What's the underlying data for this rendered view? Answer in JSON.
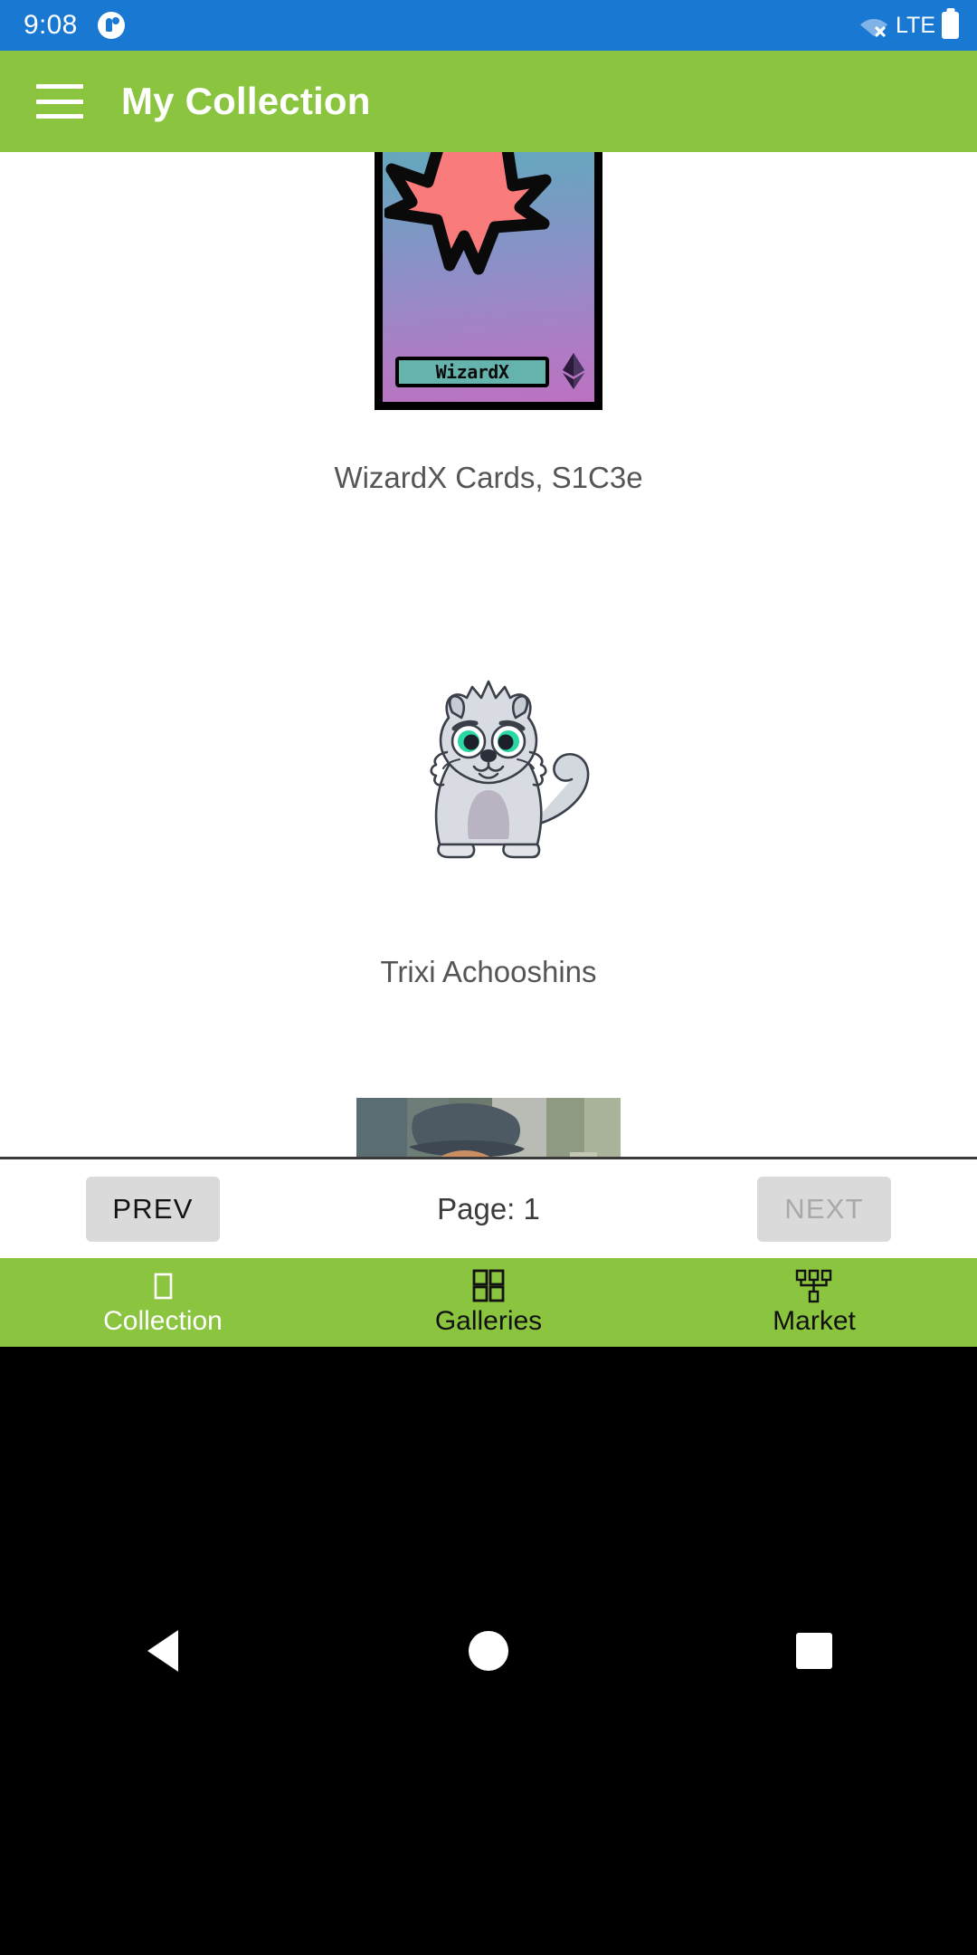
{
  "status_bar": {
    "time": "9:08",
    "notification_icon": "app-notification-icon",
    "wifi_icon": "wifi-off-icon",
    "network_label": "LTE",
    "battery_icon": "battery-icon",
    "background_color": "#1878d2"
  },
  "app_bar": {
    "menu_icon": "hamburger-menu-icon",
    "title": "My Collection",
    "background_color": "#8bc53f",
    "text_color": "#ffffff"
  },
  "collection": {
    "items": [
      {
        "caption": "WizardX Cards, S1C3e",
        "artwork_type": "wizardx-trading-card",
        "card_name": "WizardX",
        "chain_icon": "ethereum-diamond-icon"
      },
      {
        "caption": "Trixi Achooshins",
        "artwork_type": "cryptokitty-cat",
        "eye_color": "#2ad8a4",
        "fur_color": "#d3d8de"
      },
      {
        "caption": "",
        "artwork_type": "oil-painting-portrait"
      }
    ]
  },
  "pagination": {
    "prev_label": "PREV",
    "prev_enabled": true,
    "page_label": "Page:",
    "page_number": "1",
    "next_label": "NEXT",
    "next_enabled": false
  },
  "bottom_nav": {
    "background_color": "#8bc53f",
    "items": [
      {
        "label": "Collection",
        "icon": "single-square-icon",
        "active": true
      },
      {
        "label": "Galleries",
        "icon": "grid-four-squares-icon",
        "active": false
      },
      {
        "label": "Market",
        "icon": "hierarchy-tree-icon",
        "active": false
      }
    ]
  },
  "android_nav": {
    "back_icon": "back-triangle-icon",
    "home_icon": "home-circle-icon",
    "recents_icon": "recents-square-icon"
  }
}
